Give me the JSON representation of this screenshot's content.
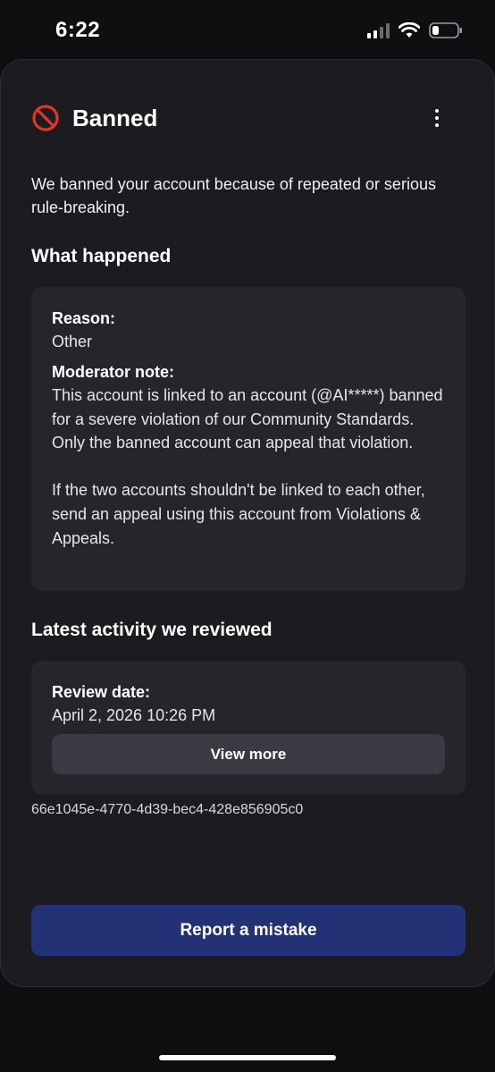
{
  "status_bar": {
    "time": "6:22",
    "icons": [
      "signal-icon",
      "wifi-icon",
      "battery-icon"
    ]
  },
  "header": {
    "title": "Banned",
    "status_icon": "ban-icon",
    "menu_icon": "more-vertical-icon"
  },
  "intro_text": "We banned your account because of repeated or serious rule-breaking.",
  "what_happened": {
    "heading": "What happened",
    "reason_label": "Reason:",
    "reason_value": "Other",
    "note_label": "Moderator note:",
    "note_paragraph_1": "This account is linked to an account (@AI*****) banned for a severe violation of our Community Standards. Only the banned account can appeal that violation.",
    "note_paragraph_2": "If the two accounts shouldn't be linked to each other, send an appeal using this account from Violations & Appeals."
  },
  "latest_activity": {
    "heading": "Latest activity we reviewed",
    "review_date_label": "Review date:",
    "review_date_value": "April 2, 2026 10:26 PM",
    "view_more_label": "View more"
  },
  "reference_id": "66e1045e-4770-4d39-bec4-428e856905c0",
  "report_button_label": "Report a mistake",
  "colors": {
    "sheet_bg": "#1b1b20",
    "card_bg": "#25252c",
    "ban_red": "#e0352b",
    "primary_button": "#233274"
  }
}
